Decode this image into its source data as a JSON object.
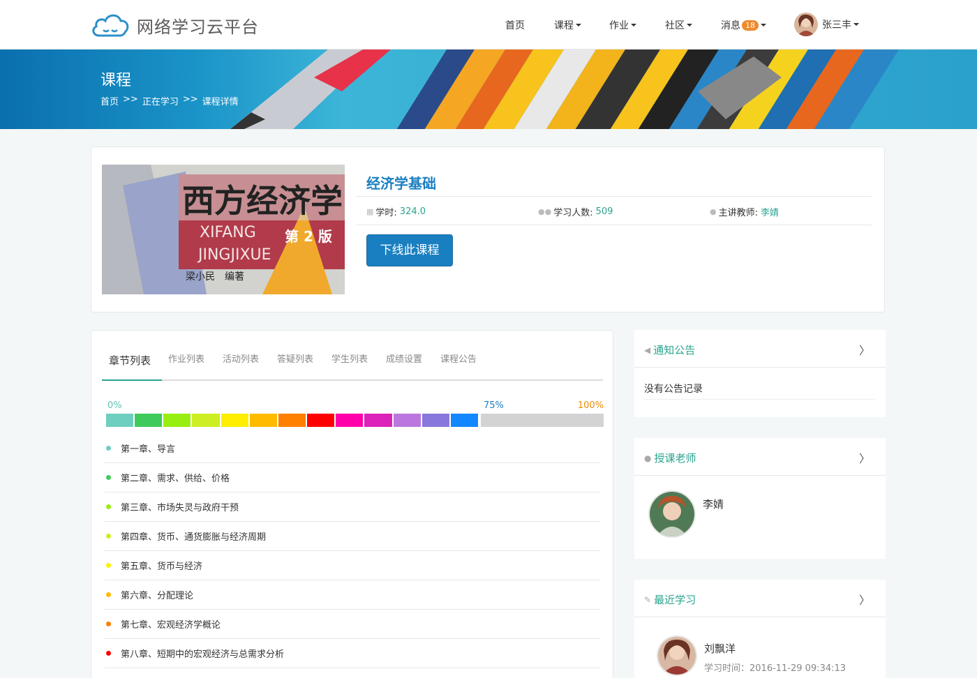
{
  "brand": {
    "name": "网络学习云平台"
  },
  "nav": {
    "home": "首页",
    "courses": "课程",
    "homework": "作业",
    "community": "社区",
    "messages": "消息",
    "message_count": "18",
    "user": "张三丰"
  },
  "banner": {
    "title": "课程",
    "breadcrumb": [
      "首页",
      ">>",
      "正在学习",
      ">>",
      "课程详情"
    ]
  },
  "course": {
    "cover": {
      "title": "西方经济学",
      "pinyin1": "XIFANG",
      "edition": "第 2 版",
      "pinyin2": "JINGJIXUE",
      "author": "梁小民　编著"
    },
    "title": "经济学基础",
    "hours_label": "学时:",
    "hours": "324.0",
    "students_label": "学习人数:",
    "students": "509",
    "teacher_label": "主讲教师:",
    "teacher": "李婧",
    "offline_button": "下线此课程"
  },
  "tabs": [
    "章节列表",
    "作业列表",
    "活动列表",
    "答疑列表",
    "学生列表",
    "成绩设置",
    "课程公告"
  ],
  "progress": {
    "label_start": "0%",
    "label_mid": "75%",
    "label_end": "100%",
    "value": 75
  },
  "colors": {
    "accent": "#2aa38f",
    "primary": "#1a7fc1",
    "segments": [
      "#6dcfc0",
      "#3ecb5b",
      "#99ee11",
      "#ccee22",
      "#ffee00",
      "#ffbb00",
      "#ff7f00",
      "#ff0000",
      "#ff00aa",
      "#dd22bb",
      "#bb77dd",
      "#8877dd",
      "#1188ff",
      "#d3d3d3"
    ]
  },
  "chapters": [
    {
      "title": "第一章、导言",
      "color": "#6dcfc0"
    },
    {
      "title": "第二章、需求、供给、价格",
      "color": "#3ecb5b"
    },
    {
      "title": "第三章、市场失灵与政府干预",
      "color": "#99ee11"
    },
    {
      "title": "第四章、货币、通货膨胀与经济周期",
      "color": "#ccee22"
    },
    {
      "title": "第五章、货币与经济",
      "color": "#ffee00"
    },
    {
      "title": "第六章、分配理论",
      "color": "#ffbb00"
    },
    {
      "title": "第七章、宏观经济学概论",
      "color": "#ff7f00"
    },
    {
      "title": "第八章、短期中的宏观经济与总需求分析",
      "color": "#ff0000"
    }
  ],
  "notice": {
    "title": "通知公告",
    "empty": "没有公告记录"
  },
  "teachers": {
    "title": "授课老师",
    "name": "李婧"
  },
  "recent": {
    "title": "最近学习",
    "name": "刘飘洋",
    "time": "学习时间：2016-11-29 09:34:13"
  }
}
